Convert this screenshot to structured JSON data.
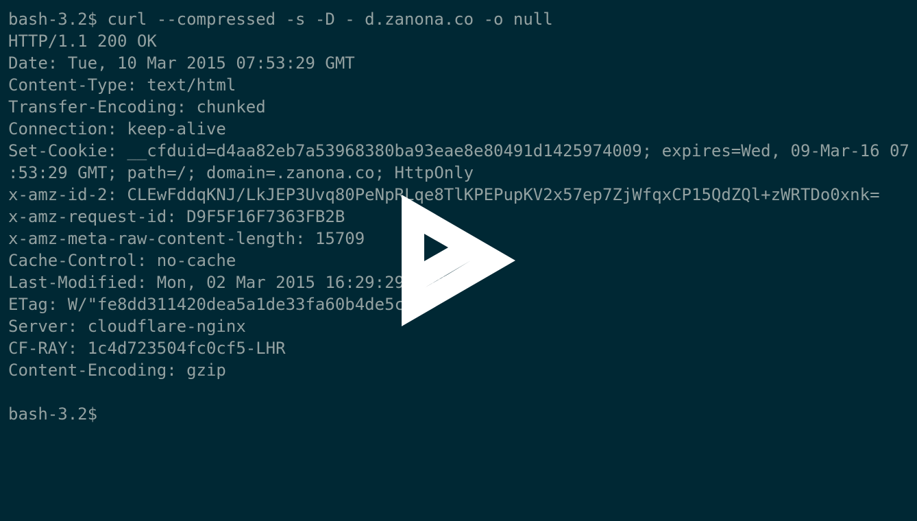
{
  "terminal": {
    "lines": [
      "bash-3.2$ curl --compressed -s -D - d.zanona.co -o null",
      "HTTP/1.1 200 OK",
      "Date: Tue, 10 Mar 2015 07:53:29 GMT",
      "Content-Type: text/html",
      "Transfer-Encoding: chunked",
      "Connection: keep-alive",
      "Set-Cookie: __cfduid=d4aa82eb7a53968380ba93eae8e80491d1425974009; expires=Wed, 09-Mar-16 07",
      ":53:29 GMT; path=/; domain=.zanona.co; HttpOnly",
      "x-amz-id-2: CLEwFddqKNJ/LkJEP3Uvq80PeNpRLqe8TlKPEPupKV2x57ep7ZjWfqxCP15QdZQl+zWRTDo0xnk=",
      "x-amz-request-id: D9F5F16F7363FB2B",
      "x-amz-meta-raw-content-length: 15709",
      "Cache-Control: no-cache",
      "Last-Modified: Mon, 02 Mar 2015 16:29:29 GMT",
      "ETag: W/\"fe8dd311420dea5a1de33fa60b4de5c",
      "Server: cloudflare-nginx",
      "CF-RAY: 1c4d723504fc0cf5-LHR",
      "Content-Encoding: gzip",
      "",
      "bash-3.2$"
    ]
  },
  "overlay": {
    "icon": "play-icon",
    "color": "#ffffff"
  },
  "colors": {
    "background": "#002834",
    "text": "#93a1a1"
  }
}
